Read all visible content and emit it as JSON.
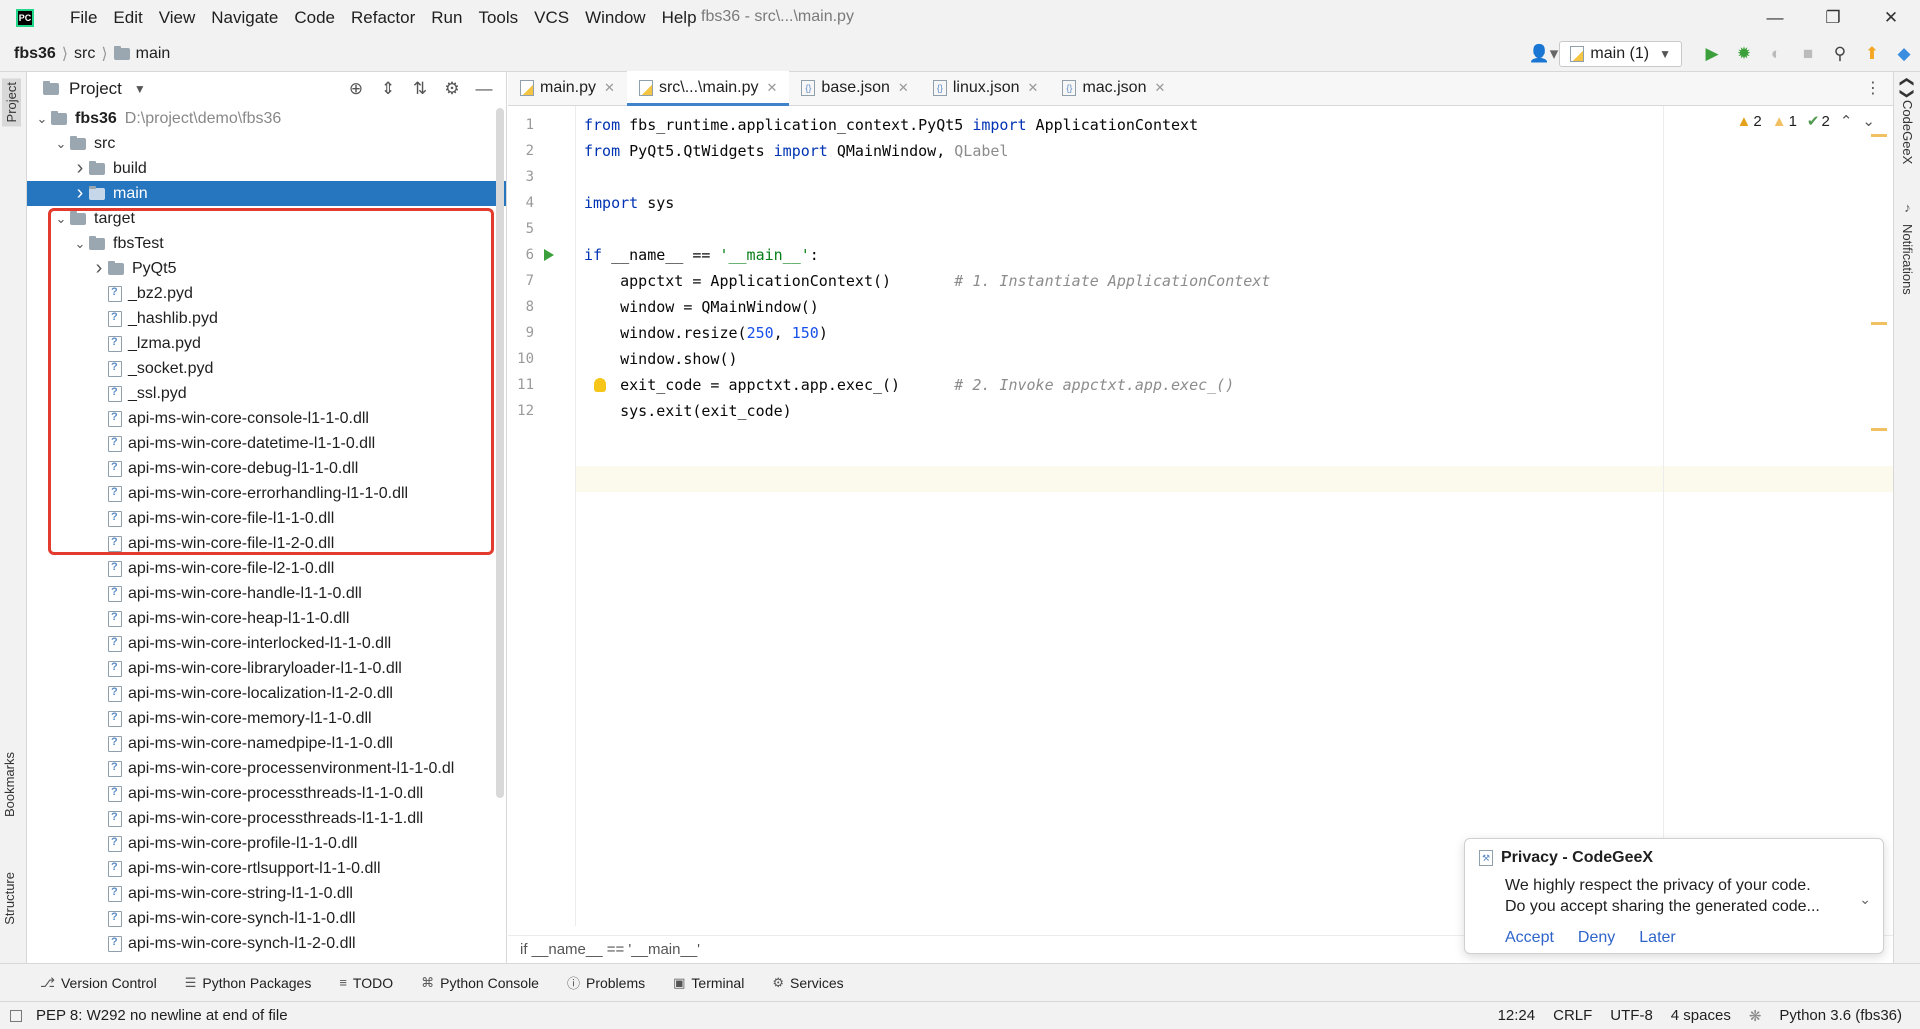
{
  "window": {
    "title": "fbs36 - src\\...\\main.py",
    "menu": [
      "File",
      "Edit",
      "View",
      "Navigate",
      "Code",
      "Refactor",
      "Run",
      "Tools",
      "VCS",
      "Window",
      "Help"
    ],
    "app_logo": "PC"
  },
  "breadcrumb": {
    "project": "fbs36",
    "parts": [
      "src",
      "main"
    ]
  },
  "run_config": {
    "label": "main (1)"
  },
  "left_strip": {
    "project": "Project",
    "bookmarks": "Bookmarks",
    "structure": "Structure"
  },
  "right_strip": {
    "codegeex": "CodeGeeX",
    "notifications": "Notifications"
  },
  "project_panel": {
    "title": "Project",
    "tree": [
      {
        "label": "fbs36",
        "path": "D:\\project\\demo\\fbs36",
        "type": "folder",
        "depth": 0,
        "expanded": true,
        "bold": true
      },
      {
        "label": "src",
        "type": "folder",
        "depth": 1,
        "expanded": true
      },
      {
        "label": "build",
        "type": "folder",
        "depth": 2,
        "expanded": false
      },
      {
        "label": "main",
        "type": "folder",
        "depth": 2,
        "expanded": false,
        "selected": true
      },
      {
        "label": "target",
        "type": "folder",
        "depth": 1,
        "expanded": true
      },
      {
        "label": "fbsTest",
        "type": "folder",
        "depth": 2,
        "expanded": true
      },
      {
        "label": "PyQt5",
        "type": "folder",
        "depth": 3,
        "expanded": false
      },
      {
        "label": "_bz2.pyd",
        "type": "file",
        "depth": 3
      },
      {
        "label": "_hashlib.pyd",
        "type": "file",
        "depth": 3
      },
      {
        "label": "_lzma.pyd",
        "type": "file",
        "depth": 3
      },
      {
        "label": "_socket.pyd",
        "type": "file",
        "depth": 3
      },
      {
        "label": "_ssl.pyd",
        "type": "file",
        "depth": 3
      },
      {
        "label": "api-ms-win-core-console-l1-1-0.dll",
        "type": "file",
        "depth": 3
      },
      {
        "label": "api-ms-win-core-datetime-l1-1-0.dll",
        "type": "file",
        "depth": 3
      },
      {
        "label": "api-ms-win-core-debug-l1-1-0.dll",
        "type": "file",
        "depth": 3
      },
      {
        "label": "api-ms-win-core-errorhandling-l1-1-0.dll",
        "type": "file",
        "depth": 3
      },
      {
        "label": "api-ms-win-core-file-l1-1-0.dll",
        "type": "file",
        "depth": 3
      },
      {
        "label": "api-ms-win-core-file-l1-2-0.dll",
        "type": "file",
        "depth": 3
      },
      {
        "label": "api-ms-win-core-file-l2-1-0.dll",
        "type": "file",
        "depth": 3
      },
      {
        "label": "api-ms-win-core-handle-l1-1-0.dll",
        "type": "file",
        "depth": 3
      },
      {
        "label": "api-ms-win-core-heap-l1-1-0.dll",
        "type": "file",
        "depth": 3
      },
      {
        "label": "api-ms-win-core-interlocked-l1-1-0.dll",
        "type": "file",
        "depth": 3
      },
      {
        "label": "api-ms-win-core-libraryloader-l1-1-0.dll",
        "type": "file",
        "depth": 3
      },
      {
        "label": "api-ms-win-core-localization-l1-2-0.dll",
        "type": "file",
        "depth": 3
      },
      {
        "label": "api-ms-win-core-memory-l1-1-0.dll",
        "type": "file",
        "depth": 3
      },
      {
        "label": "api-ms-win-core-namedpipe-l1-1-0.dll",
        "type": "file",
        "depth": 3
      },
      {
        "label": "api-ms-win-core-processenvironment-l1-1-0.dl",
        "type": "file",
        "depth": 3
      },
      {
        "label": "api-ms-win-core-processthreads-l1-1-0.dll",
        "type": "file",
        "depth": 3
      },
      {
        "label": "api-ms-win-core-processthreads-l1-1-1.dll",
        "type": "file",
        "depth": 3
      },
      {
        "label": "api-ms-win-core-profile-l1-1-0.dll",
        "type": "file",
        "depth": 3
      },
      {
        "label": "api-ms-win-core-rtlsupport-l1-1-0.dll",
        "type": "file",
        "depth": 3
      },
      {
        "label": "api-ms-win-core-string-l1-1-0.dll",
        "type": "file",
        "depth": 3
      },
      {
        "label": "api-ms-win-core-synch-l1-1-0.dll",
        "type": "file",
        "depth": 3
      },
      {
        "label": "api-ms-win-core-synch-l1-2-0.dll",
        "type": "file",
        "depth": 3
      }
    ],
    "highlight_color": "#e33b2e"
  },
  "editor": {
    "tabs": [
      {
        "label": "main.py",
        "kind": "py",
        "active": false
      },
      {
        "label": "src\\...\\main.py",
        "kind": "py",
        "active": true
      },
      {
        "label": "base.json",
        "kind": "json",
        "active": false
      },
      {
        "label": "linux.json",
        "kind": "json",
        "active": false
      },
      {
        "label": "mac.json",
        "kind": "json",
        "active": false
      }
    ],
    "inspections": {
      "warnings": "2",
      "weak_warnings": "1",
      "ok": "2"
    },
    "lines": [
      {
        "n": "1",
        "tokens": [
          [
            "kw",
            "from"
          ],
          [
            "",
            " fbs_runtime.application_context.PyQt5 "
          ],
          [
            "kw",
            "import"
          ],
          [
            "",
            " ApplicationContext"
          ]
        ]
      },
      {
        "n": "2",
        "tokens": [
          [
            "kw",
            "from"
          ],
          [
            "",
            " PyQt5.QtWidgets "
          ],
          [
            "kw",
            "import"
          ],
          [
            "",
            " QMainWindow, "
          ],
          [
            "dim",
            "QLabel"
          ]
        ]
      },
      {
        "n": "3",
        "tokens": []
      },
      {
        "n": "4",
        "tokens": [
          [
            "kw",
            "import"
          ],
          [
            "",
            " sys"
          ]
        ]
      },
      {
        "n": "5",
        "tokens": []
      },
      {
        "n": "6",
        "tokens": [
          [
            "kw",
            "if"
          ],
          [
            "",
            " __name__ == "
          ],
          [
            "str",
            "'__main__'"
          ],
          [
            "",
            ":"
          ]
        ],
        "run": true
      },
      {
        "n": "7",
        "tokens": [
          [
            "",
            "    appctxt = ApplicationContext()       "
          ],
          [
            "cm",
            "# 1. Instantiate ApplicationContext"
          ]
        ]
      },
      {
        "n": "8",
        "tokens": [
          [
            "",
            "    window = QMainWindow()"
          ]
        ]
      },
      {
        "n": "9",
        "tokens": [
          [
            "",
            "    window.resize("
          ],
          [
            "num",
            "250"
          ],
          [
            "",
            ", "
          ],
          [
            "num",
            "150"
          ],
          [
            "",
            ")"
          ]
        ]
      },
      {
        "n": "10",
        "tokens": [
          [
            "",
            "    window.show()"
          ]
        ]
      },
      {
        "n": "11",
        "tokens": [
          [
            "",
            "    exit_code = appctxt.app.exec_()      "
          ],
          [
            "cm",
            "# 2. Invoke appctxt.app.exec_()"
          ]
        ],
        "bulb": true
      },
      {
        "n": "12",
        "tokens": [
          [
            "",
            "    sys.exit(exit_code)"
          ]
        ],
        "current": true
      }
    ],
    "bottom_breadcrumb": "if __name__ == '__main__'"
  },
  "notification": {
    "title": "Privacy - CodeGeeX",
    "body_line1": "We highly respect the privacy of your code.",
    "body_line2": "Do you accept sharing the generated code...",
    "actions": [
      "Accept",
      "Deny",
      "Later"
    ]
  },
  "tool_windows": [
    {
      "label": "Version Control",
      "icon": "branch-icon"
    },
    {
      "label": "Python Packages",
      "icon": "layers-icon"
    },
    {
      "label": "TODO",
      "icon": "list-icon"
    },
    {
      "label": "Python Console",
      "icon": "python-icon"
    },
    {
      "label": "Problems",
      "icon": "info-icon"
    },
    {
      "label": "Terminal",
      "icon": "terminal-icon"
    },
    {
      "label": "Services",
      "icon": "services-icon"
    }
  ],
  "status_bar": {
    "message": "PEP 8: W292 no newline at end of file",
    "position": "12:24",
    "line_sep": "CRLF",
    "encoding": "UTF-8",
    "indent": "4 spaces",
    "interpreter": "Python 3.6 (fbs36)"
  }
}
